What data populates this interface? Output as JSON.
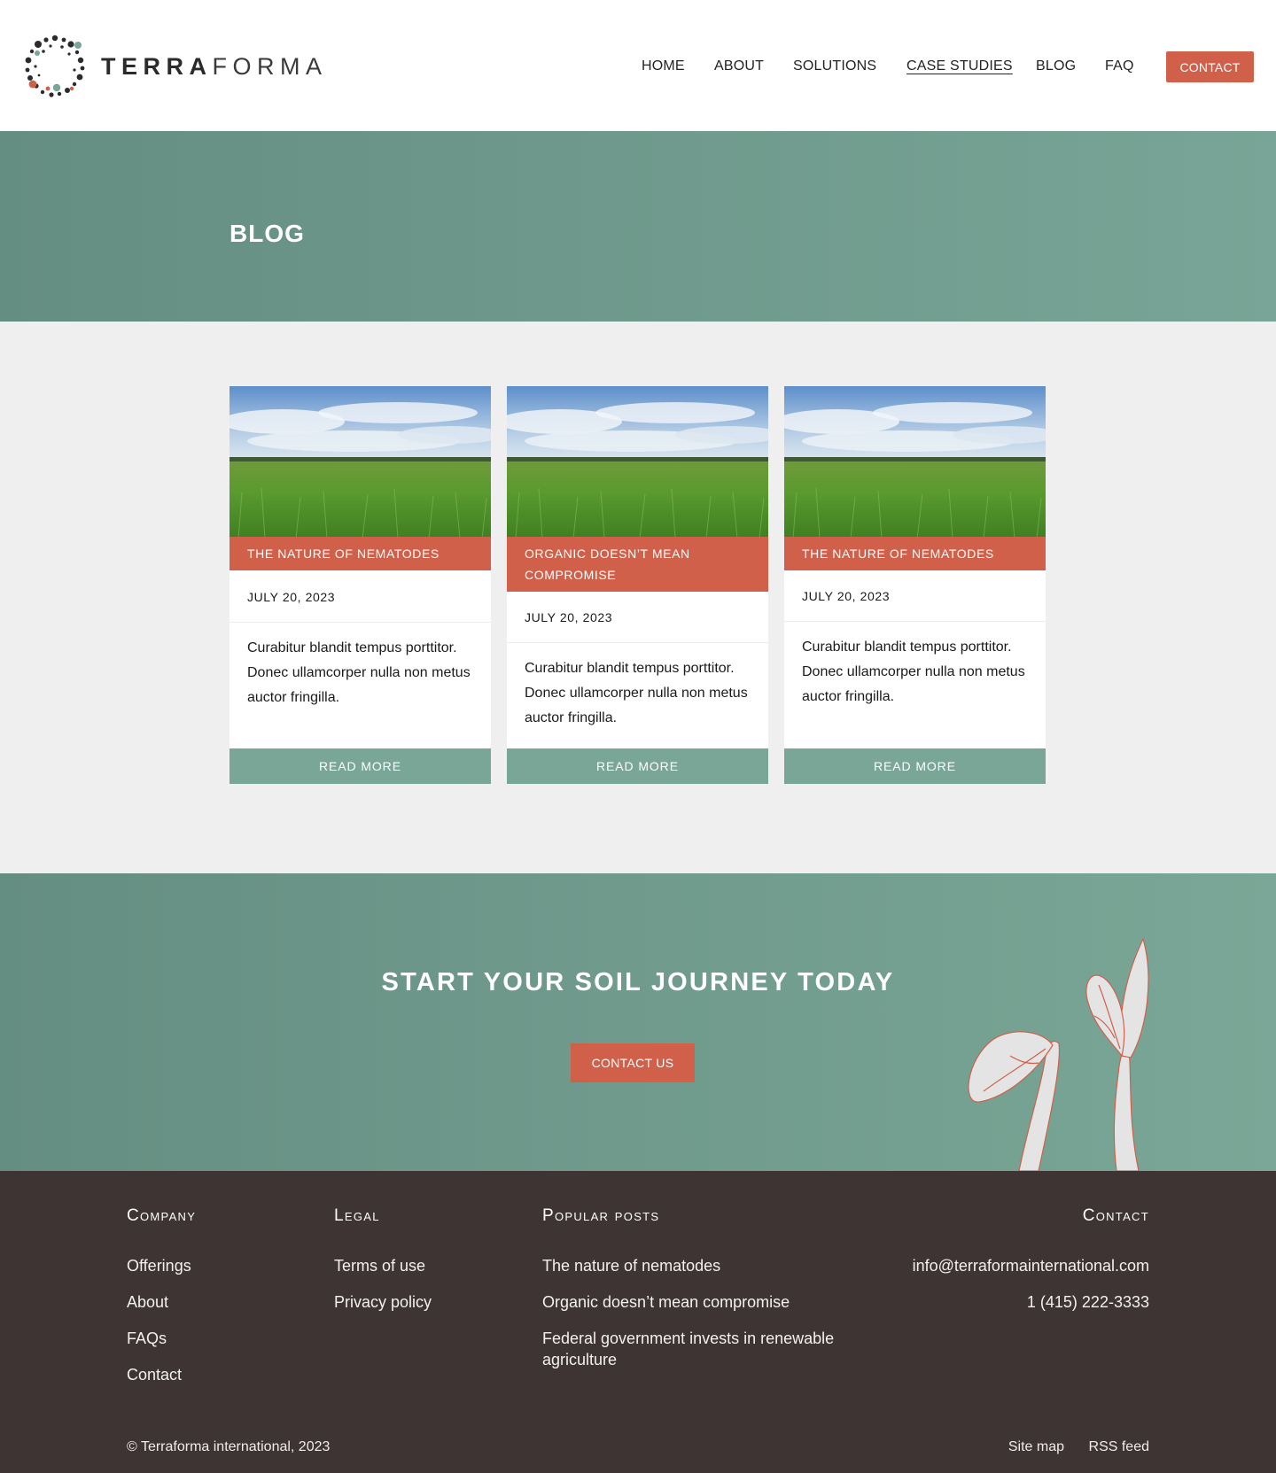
{
  "brand": {
    "name_bold": "TERRA",
    "name_light": "FORMA"
  },
  "nav": {
    "items": [
      {
        "label": "HOME"
      },
      {
        "label": "ABOUT"
      },
      {
        "label": "SOLUTIONS"
      },
      {
        "label": "CASE STUDIES",
        "active": true
      },
      {
        "label": "BLOG"
      },
      {
        "label": "FAQ"
      }
    ],
    "contact_label": "CONTACT"
  },
  "hero": {
    "title": "BLOG"
  },
  "posts": [
    {
      "title": "THE NATURE OF NEMATODES",
      "date": "JULY 20, 2023",
      "excerpt": "Curabitur blandit tempus porttitor. Donec ullamcorper nulla non metus auctor fringilla.",
      "button": "READ MORE"
    },
    {
      "title": "ORGANIC DOESN’T MEAN COMPROMISE",
      "date": "JULY 20, 2023",
      "excerpt": "Curabitur blandit tempus porttitor. Donec ullamcorper nulla non metus auctor fringilla.",
      "button": "READ MORE"
    },
    {
      "title": "THE NATURE OF NEMATODES",
      "date": "JULY 20, 2023",
      "excerpt": "Curabitur blandit tempus porttitor. Donec ullamcorper nulla non metus auctor fringilla.",
      "button": "READ MORE"
    }
  ],
  "cta": {
    "title": "START YOUR SOIL JOURNEY TODAY",
    "button": "CONTACT US"
  },
  "footer": {
    "company": {
      "heading": "Company",
      "links": [
        "Offerings",
        "About",
        "FAQs",
        "Contact"
      ]
    },
    "legal": {
      "heading": "Legal",
      "links": [
        "Terms of use",
        "Privacy policy"
      ]
    },
    "popular": {
      "heading": "Popular posts",
      "links": [
        "The nature of nematodes",
        "Organic doesn’t mean compromise",
        "Federal government invests in renewable agriculture"
      ]
    },
    "contact": {
      "heading": "Contact",
      "email": "info@terraformainternational.com",
      "phone": "1 (415) 222-3333"
    },
    "copyright": "© Terraforma international, 2023",
    "bottom_links": [
      "Site map",
      "RSS feed"
    ]
  },
  "colors": {
    "accent": "#d0604a",
    "sage": "#79a696",
    "dark": "#3d3433"
  }
}
